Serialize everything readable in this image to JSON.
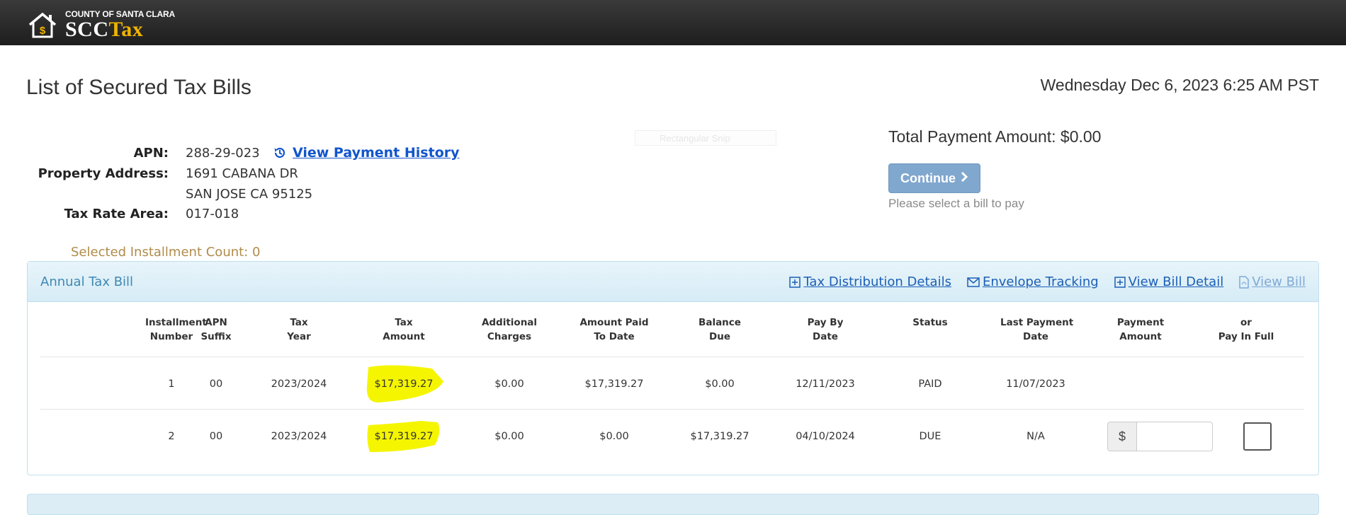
{
  "header": {
    "county": "COUNTY OF SANTA CLARA",
    "brand_scc": "SCC",
    "brand_tax": "Tax"
  },
  "page": {
    "title": "List of Secured Tax Bills",
    "datetime": "Wednesday Dec 6, 2023 6:25 AM PST"
  },
  "property": {
    "apn_label": "APN:",
    "apn": "288-29-023",
    "history_link": "View Payment History",
    "address_label": "Property Address:",
    "address_line1": "1691 CABANA DR",
    "address_line2": "SAN JOSE CA 95125",
    "tra_label": "Tax Rate Area:",
    "tra": "017-018"
  },
  "snip_overlay": "Rectangular Snip",
  "payment": {
    "total": "Total Payment Amount: $0.00",
    "continue_label": "Continue",
    "hint": "Please select a bill to pay"
  },
  "selected_count": "Selected Installment Count: 0",
  "bill_panel": {
    "title": "Annual Tax Bill",
    "links": {
      "distribution": "Tax Distribution Details",
      "envelope": "Envelope Tracking",
      "bill_detail": "View Bill Detail",
      "view_bill": "View Bill"
    },
    "columns": [
      [
        "Installment",
        "Number"
      ],
      [
        "APN",
        "Suffix"
      ],
      [
        "Tax",
        "Year"
      ],
      [
        "Tax",
        "Amount"
      ],
      [
        "Additional",
        "Charges"
      ],
      [
        "Amount Paid",
        "To Date"
      ],
      [
        "Balance",
        "Due"
      ],
      [
        "Pay By",
        "Date"
      ],
      [
        "",
        "Status"
      ],
      [
        "Last Payment",
        "Date"
      ],
      [
        "Payment",
        "Amount"
      ],
      [
        "or",
        "Pay In Full"
      ]
    ],
    "rows": [
      {
        "installment": "1",
        "suffix": "00",
        "year": "2023/2024",
        "tax_amount": "$17,319.27",
        "additional": "$0.00",
        "paid": "$17,319.27",
        "balance": "$0.00",
        "pay_by": "12/11/2023",
        "status": "PAID",
        "last_payment": "11/07/2023"
      },
      {
        "installment": "2",
        "suffix": "00",
        "year": "2023/2024",
        "tax_amount": "$17,319.27",
        "additional": "$0.00",
        "paid": "$0.00",
        "balance": "$17,319.27",
        "pay_by": "04/10/2024",
        "status": "DUE",
        "last_payment": "N/A",
        "currency_prefix": "$"
      }
    ]
  }
}
